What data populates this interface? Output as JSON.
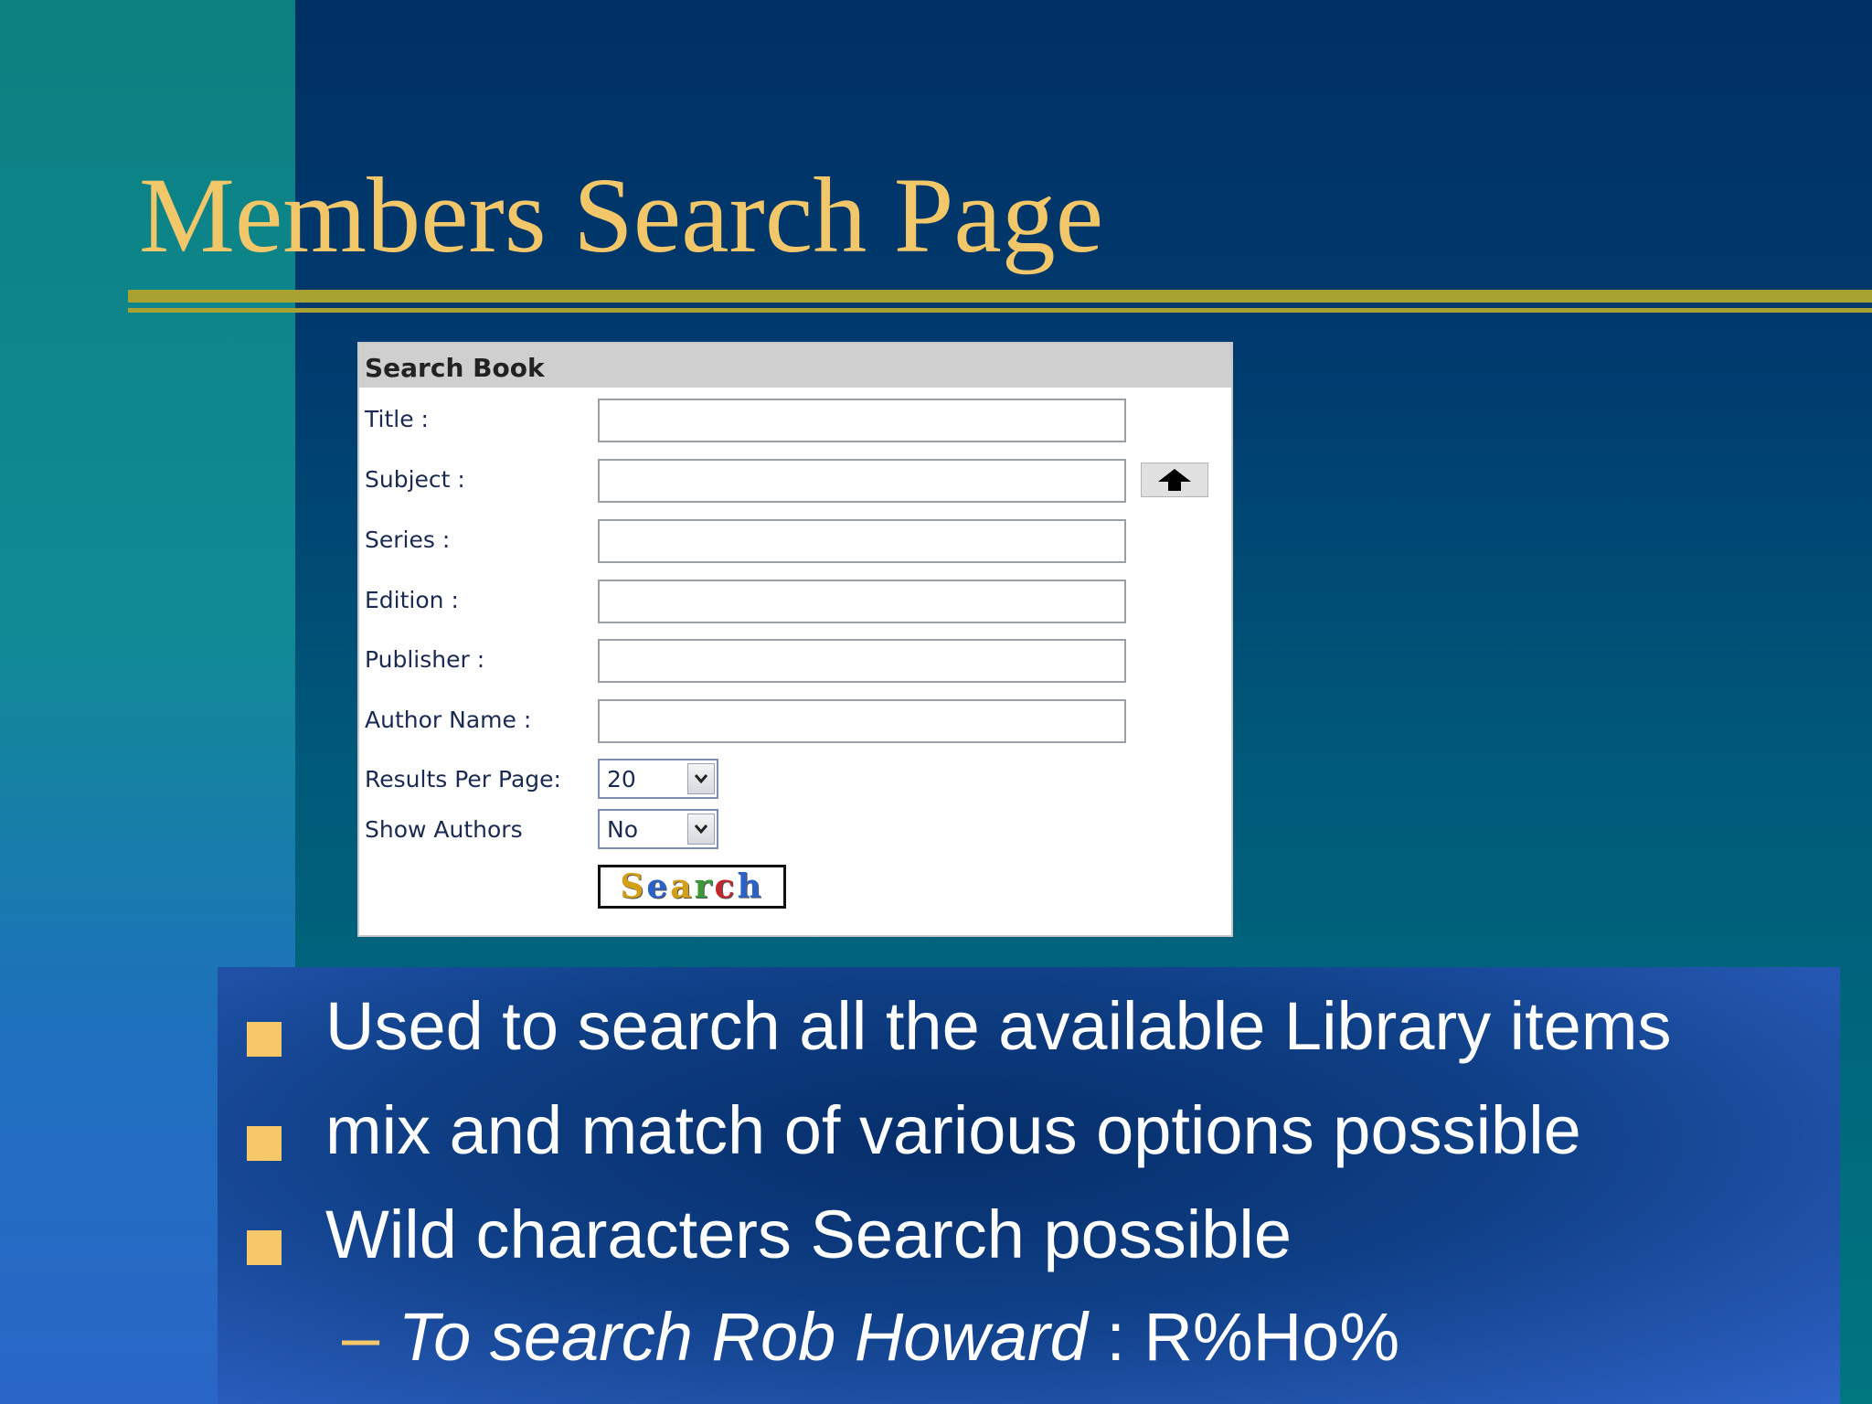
{
  "slide": {
    "title": "Members Search Page"
  },
  "panel": {
    "header": "Search Book",
    "fields": [
      {
        "label": "Title :",
        "value": ""
      },
      {
        "label": "Subject :",
        "value": ""
      },
      {
        "label": "Series :",
        "value": ""
      },
      {
        "label": "Edition :",
        "value": ""
      },
      {
        "label": "Publisher :",
        "value": ""
      },
      {
        "label": "Author Name :",
        "value": ""
      }
    ],
    "results_per_page": {
      "label": "Results Per Page:",
      "value": "20"
    },
    "show_authors": {
      "label": "Show Authors",
      "value": "No"
    },
    "search_button": "Search",
    "subject_picker_icon": "up-arrow-icon"
  },
  "bullets": {
    "items": [
      "Used to search all the available Library items",
      "mix and match of various options possible",
      "Wild characters Search possible"
    ],
    "sub": {
      "dash": "–",
      "italic": "To search Rob Howard",
      "rest": " : R%Ho%"
    }
  },
  "colors": {
    "title": "#f2c76a",
    "rule": "#a8a232",
    "bullet_marker": "#f7c86a"
  }
}
